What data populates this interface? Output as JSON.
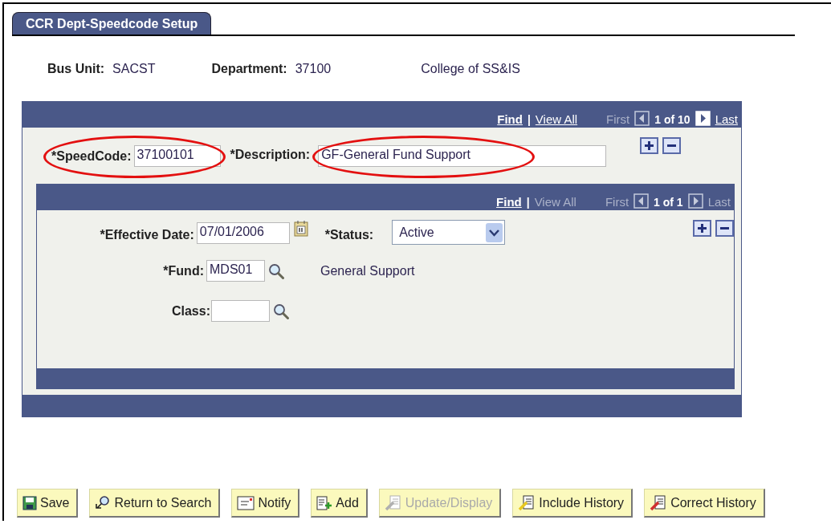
{
  "tab": {
    "label": "CCR Dept-Speedcode Setup",
    "selected": true
  },
  "header": {
    "bus_unit": {
      "label": "Bus Unit:",
      "value": "SACST"
    },
    "department": {
      "label": "Department:",
      "value": "37100",
      "description": "College of SS&IS"
    }
  },
  "outer_grid": {
    "nav": {
      "find": {
        "label": "Find",
        "disabled": false
      },
      "separator": "|",
      "view_all": {
        "label": "View All",
        "disabled": false
      },
      "first": {
        "label": "First",
        "disabled": true
      },
      "prev_disabled": true,
      "count": "1 of 10",
      "next_disabled": false,
      "last": {
        "label": "Last",
        "disabled": false
      }
    },
    "fields": [
      {
        "label": "*SpeedCode:",
        "value": "37100101",
        "circled": true
      },
      {
        "label": "*Description:",
        "value": "GF-General Fund Support",
        "circled": true
      }
    ]
  },
  "inner_grid": {
    "nav": {
      "find": {
        "label": "Find",
        "disabled": false
      },
      "separator": "|",
      "view_all": {
        "label": "View All",
        "disabled": true
      },
      "first": {
        "label": "First",
        "disabled": true
      },
      "prev_disabled": true,
      "count": "1 of 1",
      "next_disabled": true,
      "last": {
        "label": "Last",
        "disabled": true
      }
    },
    "effective_date": {
      "label": "*Effective Date:",
      "value": "07/01/2006"
    },
    "status": {
      "label": "*Status:",
      "value": "Active"
    },
    "fund": {
      "label": "*Fund:",
      "value": "MDS01",
      "description": "General Support"
    },
    "class": {
      "label": "Class:"
    }
  },
  "buttons": [
    {
      "label": "Save",
      "kind": "save",
      "disabled": false
    },
    {
      "label": "Return to Search",
      "kind": "return",
      "disabled": false
    },
    {
      "label": "Notify",
      "kind": "notify",
      "disabled": false
    },
    {
      "label": "Add",
      "kind": "add",
      "disabled": false
    },
    {
      "label": "Update/Display",
      "kind": "update",
      "disabled": true
    },
    {
      "label": "Include History",
      "kind": "include",
      "disabled": false
    },
    {
      "label": "Correct History",
      "kind": "correct",
      "disabled": false
    }
  ]
}
